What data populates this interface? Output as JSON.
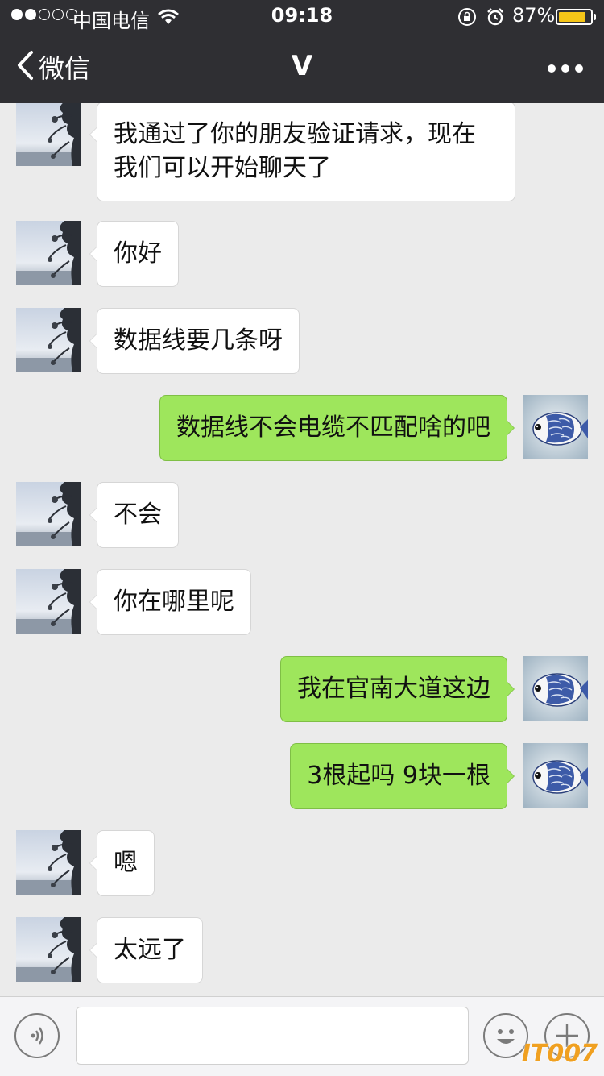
{
  "status_bar": {
    "carrier": "中国电信",
    "time": "09:18",
    "battery_percent": "87%",
    "battery_level": 0.87,
    "signal_bars_filled": 2,
    "signal_bars_total": 5
  },
  "nav": {
    "back_label": "微信",
    "title": "V"
  },
  "messages": [
    {
      "side": "left",
      "text": "我通过了你的朋友验证请求，现在我们可以开始聊天了"
    },
    {
      "side": "left",
      "text": "你好"
    },
    {
      "side": "left",
      "text": "数据线要几条呀"
    },
    {
      "side": "right",
      "text": "数据线不会电缆不匹配啥的吧"
    },
    {
      "side": "left",
      "text": "不会"
    },
    {
      "side": "left",
      "text": "你在哪里呢"
    },
    {
      "side": "right",
      "text": "我在官南大道这边"
    },
    {
      "side": "right",
      "text": "3根起吗 9块一根"
    },
    {
      "side": "left",
      "text": "嗯"
    },
    {
      "side": "left",
      "text": "太远了"
    }
  ],
  "input": {
    "placeholder": ""
  },
  "watermark": "IT007",
  "colors": {
    "topbar": "#2f2f33",
    "chat_background": "#ebebeb",
    "sent_bubble": "#9ee65c",
    "received_bubble": "#ffffff",
    "battery": "#f5c518"
  },
  "icons": {
    "back": "chevron-left-icon",
    "more": "more-dots-icon",
    "voice": "voice-icon",
    "emoji": "emoji-icon",
    "plus": "plus-icon"
  }
}
